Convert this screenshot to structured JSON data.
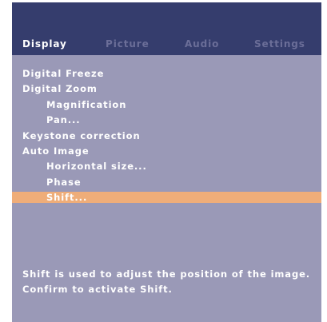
{
  "tabs": [
    {
      "label": "Display",
      "active": true
    },
    {
      "label": "Picture",
      "active": false
    },
    {
      "label": "Audio",
      "active": false
    },
    {
      "label": "Settings",
      "active": false
    }
  ],
  "menu": {
    "items": [
      {
        "label": "Digital Freeze",
        "level": 0,
        "selected": false
      },
      {
        "label": "Digital Zoom",
        "level": 0,
        "selected": false
      },
      {
        "label": "Magnification",
        "level": 1,
        "selected": false
      },
      {
        "label": "Pan...",
        "level": 1,
        "selected": false
      },
      {
        "label": "Keystone correction",
        "level": 0,
        "selected": false
      },
      {
        "label": "Auto Image",
        "level": 0,
        "selected": false
      },
      {
        "label": "Horizontal size...",
        "level": 1,
        "selected": false
      },
      {
        "label": "Phase",
        "level": 1,
        "selected": false
      },
      {
        "label": "Shift...",
        "level": 1,
        "selected": true
      }
    ]
  },
  "help": {
    "line1": "Shift is used to adjust the position of the image.",
    "line2": "Confirm to activate Shift."
  },
  "colors": {
    "header_bg": "#353d6d",
    "panel_bg": "#9a99b7",
    "selection_bg": "#efad79",
    "inactive_tab": "#6b6e98",
    "text": "#ffffff"
  }
}
